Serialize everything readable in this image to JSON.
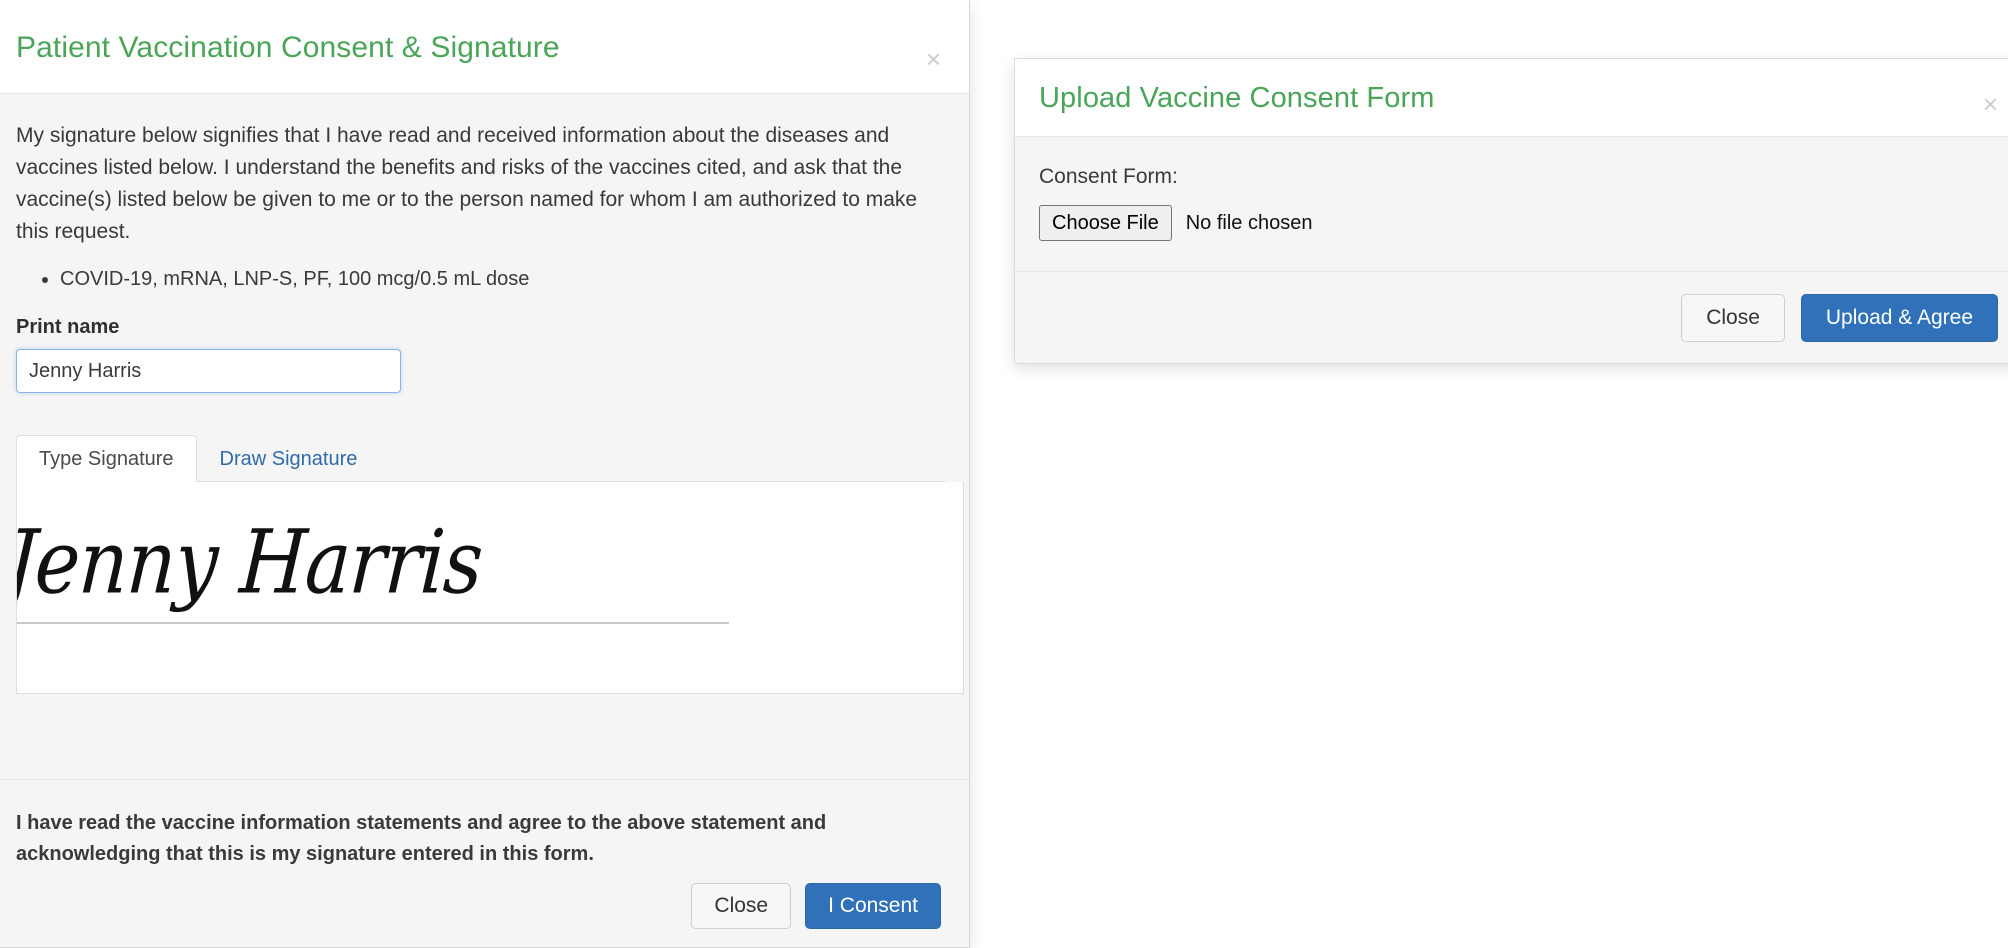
{
  "consent_modal": {
    "title": "Patient Vaccination Consent & Signature",
    "close_icon": "×",
    "paragraph": "My signature below signifies that I have read and received information about the diseases and vaccines listed below. I understand the benefits and risks of the vaccines cited, and ask that the vaccine(s) listed below be given to me or to the person named for whom I am authorized to make this request.",
    "vaccines": [
      "COVID-19, mRNA, LNP-S, PF, 100 mcg/0.5 mL dose"
    ],
    "print_name": {
      "label": "Print name",
      "value": "Jenny Harris",
      "placeholder": ""
    },
    "signature_tabs": [
      {
        "label": "Type Signature",
        "active": true
      },
      {
        "label": "Draw Signature",
        "active": false
      }
    ],
    "signature_value": "Jenny Harris",
    "agreement_text": "I have read the vaccine information statements and agree to the above statement and acknowledging that this is my signature entered in this form.",
    "buttons": {
      "close": "Close",
      "consent": "I Consent"
    }
  },
  "upload_modal": {
    "title": "Upload Vaccine Consent Form",
    "close_icon": "×",
    "field_label": "Consent Form:",
    "file_input": {
      "button_label": "Choose File",
      "status": "No file chosen"
    },
    "buttons": {
      "close": "Close",
      "upload": "Upload & Agree"
    }
  },
  "colors": {
    "title_green": "#4aa559",
    "primary_blue": "#3071b9",
    "link_blue": "#2f6bab",
    "body_grey": "#f5f5f5"
  }
}
